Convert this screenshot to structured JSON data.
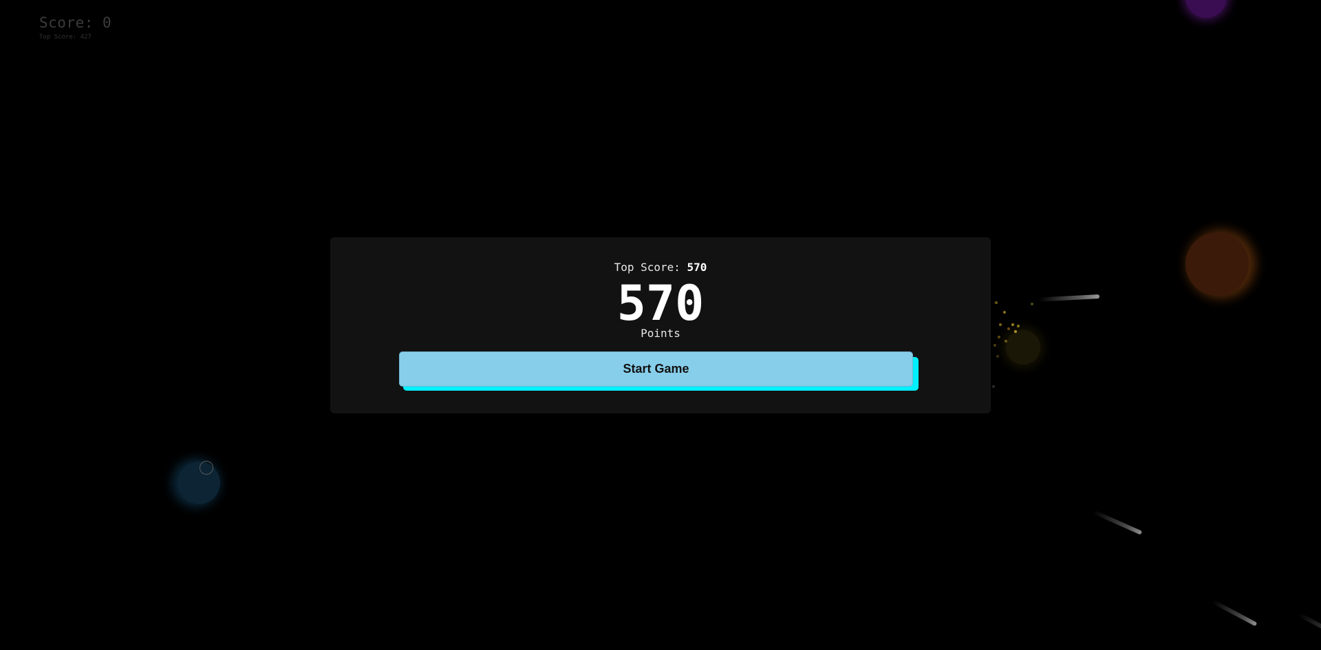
{
  "hud": {
    "score_text": "Score: 0",
    "top_score_text": "Top Score: 427"
  },
  "modal": {
    "top_score_label": "Top Score:",
    "top_score_value": "570",
    "score_value": "570",
    "points_label": "Points",
    "start_button_label": "Start Game"
  },
  "colors": {
    "background": "#000000",
    "panel": "#121212",
    "button": "#87ceeb",
    "button_shadow": "#00f0ff",
    "hud_text": "#3c3c3c"
  }
}
